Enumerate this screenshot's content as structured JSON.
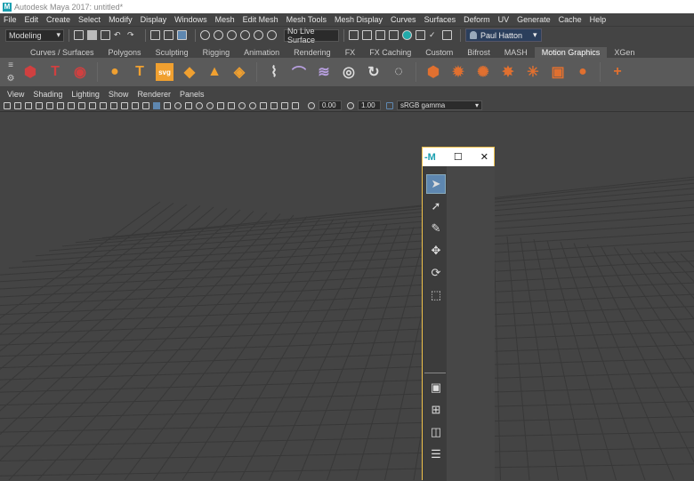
{
  "window": {
    "title": "Autodesk Maya 2017: untitled*",
    "logo": "M"
  },
  "menu": [
    "File",
    "Edit",
    "Create",
    "Select",
    "Modify",
    "Display",
    "Windows",
    "Mesh",
    "Edit Mesh",
    "Mesh Tools",
    "Mesh Display",
    "Curves",
    "Surfaces",
    "Deform",
    "UV",
    "Generate",
    "Cache",
    "Help"
  ],
  "status": {
    "menuset": "Modeling",
    "live_surface": "No Live Surface",
    "user": "Paul Hatton"
  },
  "shelf_tabs": [
    "Curves / Surfaces",
    "Polygons",
    "Sculpting",
    "Rigging",
    "Animation",
    "Rendering",
    "FX",
    "FX Caching",
    "Custom",
    "Bifrost",
    "MASH",
    "Motion Graphics",
    "XGen"
  ],
  "shelf_active": "Motion Graphics",
  "shelf_icons": [
    {
      "name": "cube-icon",
      "glyph": "⬢",
      "color": "#d04040"
    },
    {
      "name": "text-icon",
      "glyph": "T",
      "color": "#d04040"
    },
    {
      "name": "sphere-icon",
      "glyph": "◉",
      "color": "#d04040"
    },
    {
      "name": "soccer-ball-icon",
      "glyph": "●",
      "color": "#f0a030"
    },
    {
      "name": "type-icon",
      "glyph": "T",
      "color": "#f0a030"
    },
    {
      "name": "svg-icon",
      "glyph": "svg",
      "color": "#f0a030"
    },
    {
      "name": "box-icon",
      "glyph": "◆",
      "color": "#f0a030"
    },
    {
      "name": "bevel-icon",
      "glyph": "▲",
      "color": "#f0a030"
    },
    {
      "name": "extrude-icon",
      "glyph": "◈",
      "color": "#f0a030"
    },
    {
      "name": "curve-icon",
      "glyph": "⌇",
      "color": "#ddd"
    },
    {
      "name": "arc-icon",
      "glyph": "⌒",
      "color": "#b8a0e0"
    },
    {
      "name": "wind-icon",
      "glyph": "≋",
      "color": "#b8a0e0"
    },
    {
      "name": "spiral-icon",
      "glyph": "◎",
      "color": "#ddd"
    },
    {
      "name": "cycle-icon",
      "glyph": "↻",
      "color": "#ddd"
    },
    {
      "name": "ring-icon",
      "glyph": "◌",
      "color": "#ddd"
    },
    {
      "name": "mash-cube-icon",
      "glyph": "⬢",
      "color": "#e07030"
    },
    {
      "name": "mash-gear-icon",
      "glyph": "✹",
      "color": "#e07030"
    },
    {
      "name": "mash-burst-icon",
      "glyph": "✺",
      "color": "#e07030"
    },
    {
      "name": "mash-spike-icon",
      "glyph": "✸",
      "color": "#e07030"
    },
    {
      "name": "mash-flare-icon",
      "glyph": "✳",
      "color": "#e07030"
    },
    {
      "name": "mash-box-icon",
      "glyph": "▣",
      "color": "#e07030"
    },
    {
      "name": "mash-drop-icon",
      "glyph": "●",
      "color": "#e07030"
    },
    {
      "name": "plus-icon",
      "glyph": "+",
      "color": "#e07030"
    }
  ],
  "panel_menu": [
    "View",
    "Shading",
    "Lighting",
    "Show",
    "Renderer",
    "Panels"
  ],
  "panel_fields": {
    "exposure": "0.00",
    "gamma": "1.00",
    "colorspace": "sRGB gamma"
  },
  "toolbox": {
    "logo": "-M",
    "maximize": "☐",
    "close": "✕"
  },
  "colors": {
    "viewport": "#444444",
    "grid": "#555555",
    "accent": "#5e87b0",
    "highlight": "#f0c14b"
  }
}
